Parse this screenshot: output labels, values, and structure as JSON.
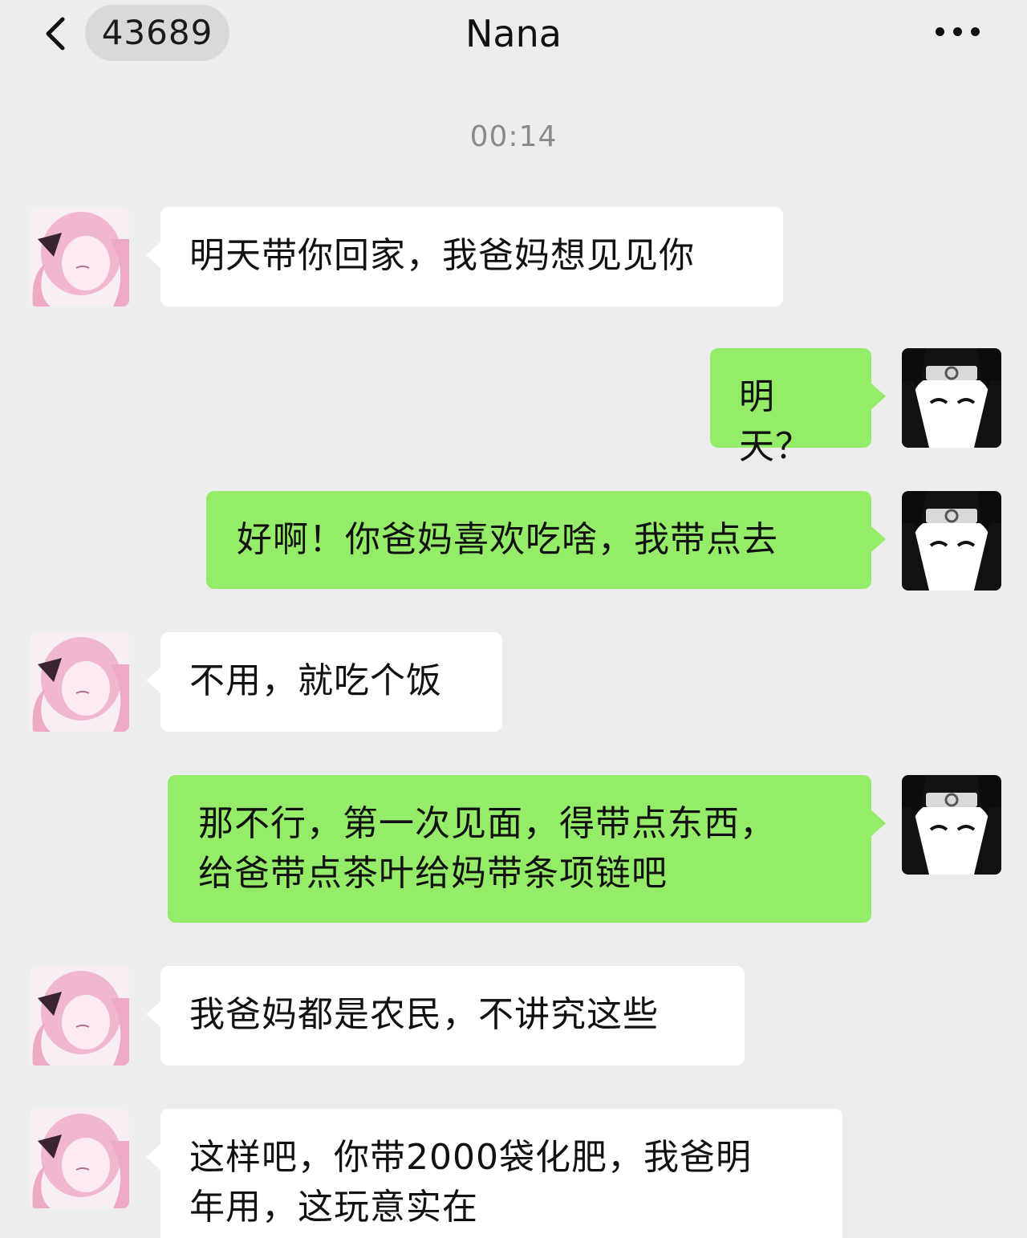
{
  "header": {
    "back_icon": "chevron-left-icon",
    "unread_count": "43689",
    "title": "Nana",
    "more_icon": "more-dots-icon"
  },
  "timestamp": "00:14",
  "messages": [
    {
      "side": "left",
      "avatar": "anime-girl-avatar",
      "lines": [
        "明天带你回家，我爸妈想见见你"
      ]
    },
    {
      "side": "right",
      "avatar": "ninja-avatar",
      "lines": [
        "明天？"
      ]
    },
    {
      "side": "right",
      "avatar": "ninja-avatar",
      "lines": [
        "好啊！你爸妈喜欢吃啥，我带点去"
      ]
    },
    {
      "side": "left",
      "avatar": "anime-girl-avatar",
      "lines": [
        "不用，就吃个饭"
      ]
    },
    {
      "side": "right",
      "avatar": "ninja-avatar",
      "lines": [
        "那不行，第一次见面，得带点东西，",
        "给爸带点茶叶给妈带条项链吧"
      ]
    },
    {
      "side": "left",
      "avatar": "anime-girl-avatar",
      "lines": [
        "我爸妈都是农民，不讲究这些"
      ]
    },
    {
      "side": "left",
      "avatar": "anime-girl-avatar",
      "lines": [
        "这样吧，你带2000袋化肥，我爸明",
        "年用，这玩意实在"
      ]
    }
  ],
  "colors": {
    "background": "#ededed",
    "self_bubble": "#95ec69",
    "other_bubble": "#ffffff",
    "timestamp": "#8a8a8a"
  }
}
